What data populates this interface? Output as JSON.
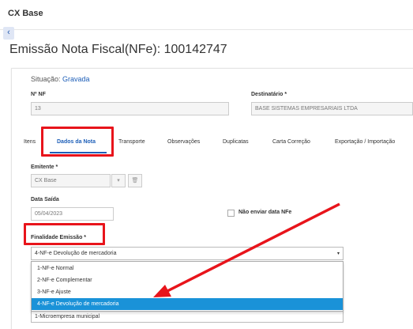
{
  "app": {
    "title": "CX Base",
    "back_label": "‹"
  },
  "page": {
    "title": "Emissão Nota Fiscal(NFe): 100142747"
  },
  "status": {
    "label": "Situação:",
    "value": "Gravada"
  },
  "nf": {
    "label": "Nº NF",
    "value": "13"
  },
  "destinatario": {
    "label": "Destinatário *",
    "value": "BASE SISTEMAS EMPRESARIAIS LTDA"
  },
  "tabs": [
    {
      "label": "Itens"
    },
    {
      "label": "Dados da Nota"
    },
    {
      "label": "Transporte"
    },
    {
      "label": "Observações"
    },
    {
      "label": "Duplicatas"
    },
    {
      "label": "Carta Correção"
    },
    {
      "label": "Exportação / Importação"
    }
  ],
  "emitente": {
    "label": "Emitente *",
    "value": "CX Base",
    "dropdown_icon": "▾",
    "delete_icon": "🗑"
  },
  "data_saida": {
    "label": "Data Saída",
    "value": "05/04/2023"
  },
  "nao_enviar": {
    "label": "Não enviar data NFe"
  },
  "finalidade": {
    "label": "Finalidade Emissão *",
    "selected": "4-NF-e Devolução de mercadoria",
    "caret": "▾",
    "options": [
      "1-NF-e Normal",
      "2-NF-e Complementar",
      "3-NF-e Ajuste",
      "4-NF-e Devolução de mercadoria"
    ]
  },
  "behind_field": {
    "value": "1-Microempresa municipal"
  },
  "colors": {
    "accent": "#1e5fb8",
    "highlight": "#e8141b",
    "selected_option": "#1a92d8"
  }
}
